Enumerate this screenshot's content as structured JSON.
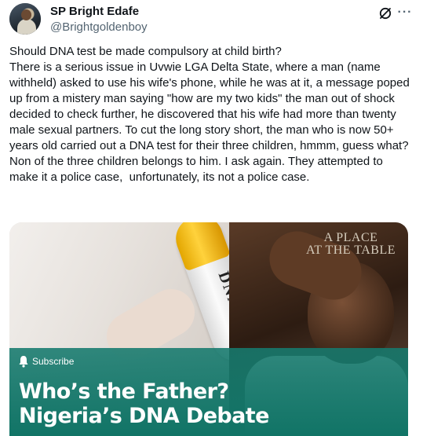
{
  "author": {
    "name": "SP Bright Edafe",
    "handle": "@Brightgoldenboy"
  },
  "icons": {
    "grok": "grok-icon",
    "more": "more-icon",
    "bell": "bell-icon"
  },
  "more_glyph": "···",
  "tweet": {
    "text": "Should DNA test be made compulsory at child birth?\nThere is a serious issue in Uvwie LGA Delta State, where a man (name withheld) asked to use his wife's phone, while he was at it, a message poped up from a mistery man saying \"how are my two kids\" the man out of shock decided to check further, he discovered that his wife had more than twenty male sexual partners. To cut the long story short, the man who is now 50+ years old carried out a DNA test for their three children, hmmm, guess what? Non of the three children belongs to him. I ask again. They attempted to make it a police case,  unfortunately, its not a police case."
  },
  "media": {
    "logo_line1": "A PLACE",
    "logo_line2": "AT THE TABLE",
    "tube_label": "DNA",
    "subscribe": "Subscribe",
    "headline_line1": "Who’s the Father?",
    "headline_line2": "Nigeria’s DNA Debate"
  },
  "colors": {
    "text": "#0f1419",
    "secondary": "#536471",
    "band": "#117466"
  }
}
